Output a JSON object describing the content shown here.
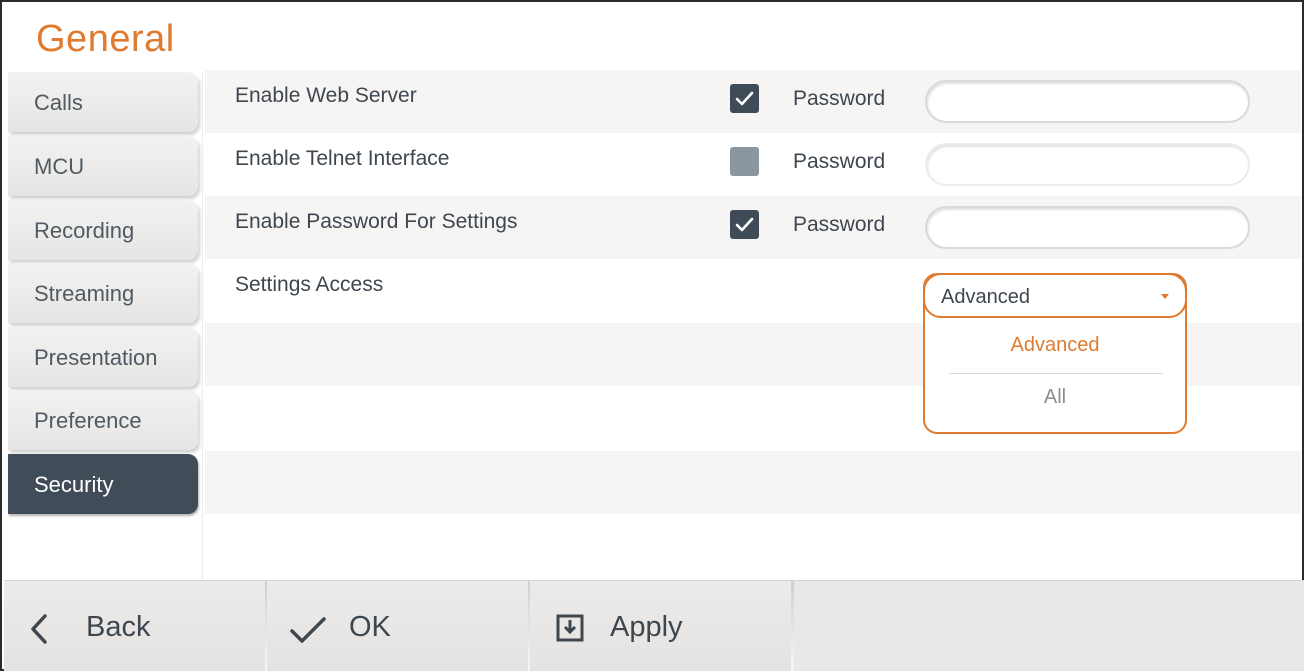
{
  "page": {
    "title": "General"
  },
  "sidebar": {
    "items": [
      {
        "label": "Calls",
        "active": false
      },
      {
        "label": "MCU",
        "active": false
      },
      {
        "label": "Recording",
        "active": false
      },
      {
        "label": "Streaming",
        "active": false
      },
      {
        "label": "Presentation",
        "active": false
      },
      {
        "label": "Preference",
        "active": false
      },
      {
        "label": "Security",
        "active": true
      }
    ]
  },
  "settings": {
    "web_server": {
      "label": "Enable Web Server",
      "checked": true,
      "password_label": "Password",
      "password_value": ""
    },
    "telnet": {
      "label": "Enable Telnet Interface",
      "checked": false,
      "password_label": "Password",
      "password_value": ""
    },
    "settings_password": {
      "label": "Enable Password For Settings",
      "checked": true,
      "password_label": "Password",
      "password_value": ""
    },
    "access": {
      "label": "Settings Access",
      "selected": "Advanced",
      "options": [
        "Advanced",
        "All"
      ]
    }
  },
  "footer": {
    "back_label": "Back",
    "ok_label": "OK",
    "apply_label": "Apply"
  },
  "colors": {
    "accent": "#e07a2e",
    "active_nav": "#404c57",
    "checkbox_on": "#3f4b56",
    "checkbox_off": "#8a97a1"
  },
  "icons": {
    "back": "chevron-left-icon",
    "ok": "checkmark-icon",
    "apply": "save-download-icon"
  }
}
